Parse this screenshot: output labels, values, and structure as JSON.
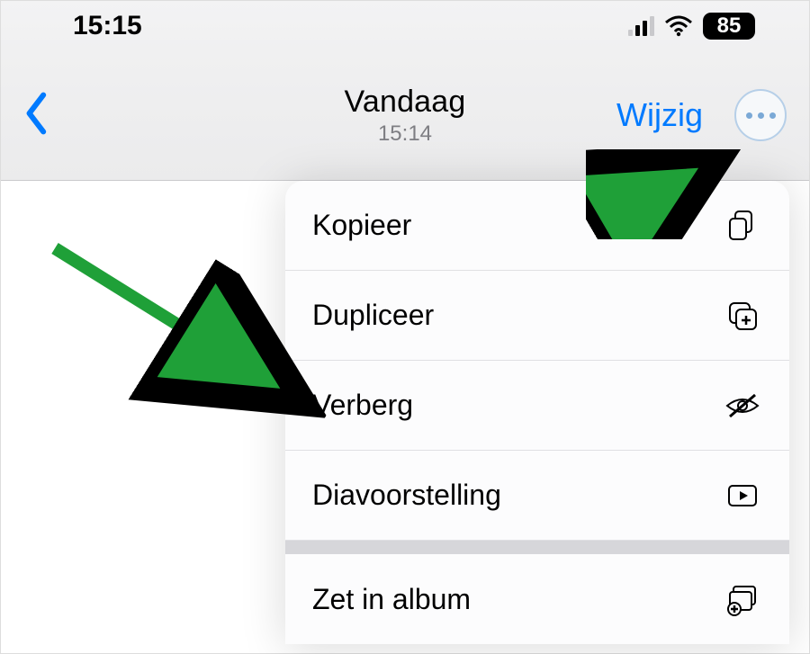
{
  "status": {
    "time": "15:15",
    "battery": "85"
  },
  "nav": {
    "title": "Vandaag",
    "subtitle": "15:14",
    "edit_label": "Wijzig"
  },
  "menu": {
    "items": [
      {
        "label": "Kopieer"
      },
      {
        "label": "Dupliceer"
      },
      {
        "label": "Verberg"
      },
      {
        "label": "Diavoorstelling"
      },
      {
        "label": "Zet in album"
      }
    ]
  },
  "colors": {
    "accent": "#007aff",
    "annotation": "#1fa038"
  }
}
